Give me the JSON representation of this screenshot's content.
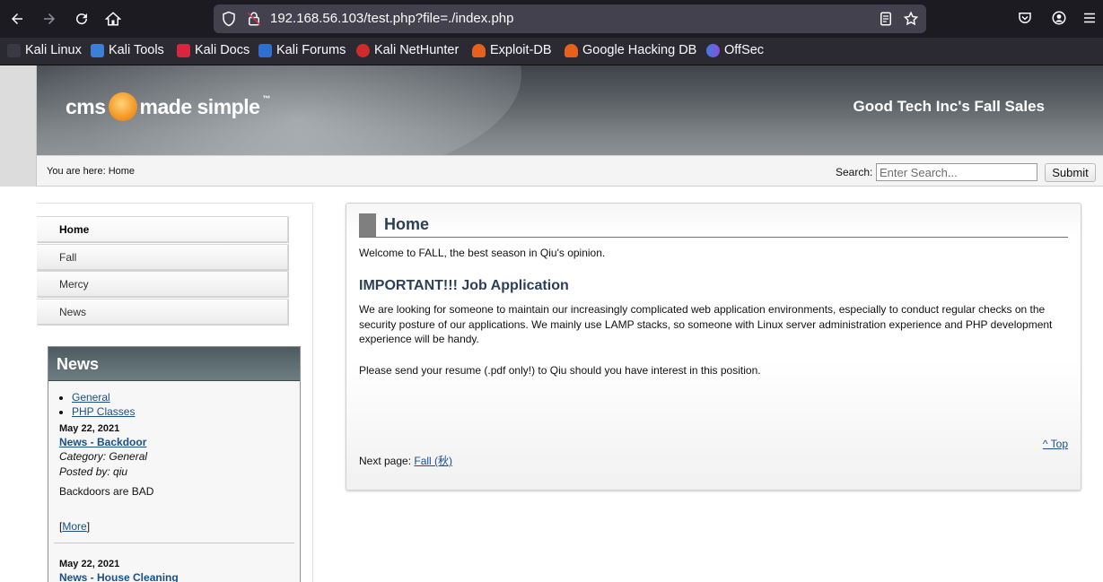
{
  "browser": {
    "url": "192.168.56.103/test.php?file=./index.php",
    "bookmarks": [
      {
        "label": "Kali Linux",
        "color": "#2f7bd1"
      },
      {
        "label": "Kali Tools",
        "color": "#3c7fd6"
      },
      {
        "label": "Kali Docs",
        "color": "#d7263d"
      },
      {
        "label": "Kali Forums",
        "color": "#2f6fd1"
      },
      {
        "label": "Kali NetHunter",
        "color": "#cf2b2b"
      },
      {
        "label": "Exploit-DB",
        "color": "#e8611c"
      },
      {
        "label": "Google Hacking DB",
        "color": "#e8611c"
      },
      {
        "label": "OffSec",
        "color": "#6d4bd1"
      }
    ]
  },
  "header": {
    "logo_text": "cms made simple",
    "site_title": "Good Tech Inc's Fall Sales"
  },
  "crumbs": {
    "you_are_here": "You are here: Home"
  },
  "search": {
    "label": "Search:",
    "placeholder": "Enter Search...",
    "submit": "Submit"
  },
  "menu": [
    {
      "label": "Home",
      "active": true
    },
    {
      "label": "Fall",
      "active": false
    },
    {
      "label": "Mercy",
      "active": false
    },
    {
      "label": "News",
      "active": false
    }
  ],
  "news": {
    "title": "News",
    "categories": [
      "General",
      "PHP Classes"
    ],
    "items": [
      {
        "date": "May 22, 2021",
        "title": "News - Backdoor",
        "category": "Category: General",
        "posted_by": "Posted by: qiu",
        "summary": "Backdoors are BAD",
        "more_prefix": "[",
        "more_label": "More",
        "more_suffix": "]"
      },
      {
        "date": "May 22, 2021",
        "title": "News - House Cleaning"
      }
    ]
  },
  "content": {
    "title": "Home",
    "welcome": "Welcome to FALL, the best season in Qiu's opinion.",
    "job_heading": "IMPORTANT!!! Job Application",
    "job_text": "We are looking for someone to maintain our increasingly complicated web application environments, especially to conduct regular checks on the security posture of our applications. We mainly use LAMP stacks, so someone with Linux server administration experience and PHP development experience will be handy.",
    "resume_text": "Please send your resume (.pdf only!) to Qiu should you have interest in this position.",
    "top_link": "^ Top",
    "next_page_label": "Next page:",
    "next_page_link": "Fall (秋)"
  }
}
